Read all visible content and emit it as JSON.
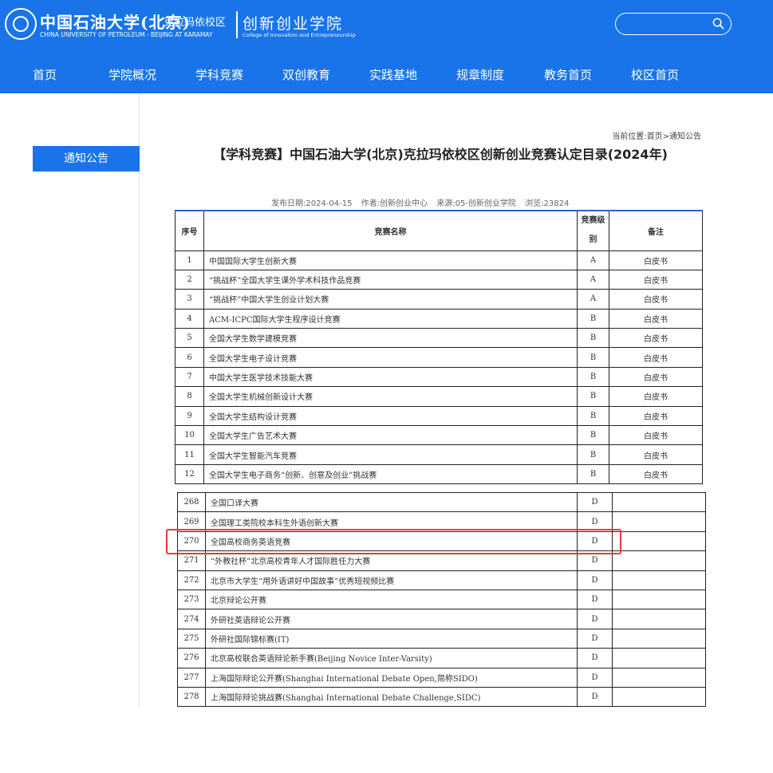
{
  "header": {
    "school_name_cn": "中国石油大学(北京)",
    "campus_name": "克拉玛依校区",
    "school_name_en": "CHINA UNIVERSITY OF PETROLEUM - BEIJING  AT KARAMAY",
    "college_name_cn": "创新创业学院",
    "college_name_en": "College of Innovation and Entrepreneurship",
    "search_placeholder": ""
  },
  "nav": [
    "首页",
    "学院概况",
    "学科竞赛",
    "双创教育",
    "实践基地",
    "规章制度",
    "教务首页",
    "校区首页"
  ],
  "sidebar": {
    "active_item": "通知公告"
  },
  "breadcrumb": {
    "prefix": "当前位置:",
    "home": "首页",
    "sep": ">",
    "current": "通知公告"
  },
  "article": {
    "title": "【学科竞赛】中国石油大学(北京)克拉玛依校区创新创业竞赛认定目录(2024年)",
    "meta": {
      "date": "发布日期:2024-04-15",
      "author": "作者:创新创业中心",
      "source": "来源:05-创新创业学院",
      "views": "浏览:23824"
    }
  },
  "table": {
    "headers": {
      "num": "序号",
      "name": "竞赛名称",
      "level": "竞赛级别",
      "note": "备注"
    },
    "top_rows": [
      {
        "num": "1",
        "name": "中国国际大学生创新大赛",
        "level": "A",
        "note": "白皮书"
      },
      {
        "num": "2",
        "name": "“挑战杯”全国大学生课外学术科技作品竞赛",
        "level": "A",
        "note": "白皮书"
      },
      {
        "num": "3",
        "name": "“挑战杯”中国大学生创业计划大赛",
        "level": "A",
        "note": "白皮书"
      },
      {
        "num": "4",
        "name": "ACM-ICPC国际大学生程序设计竞赛",
        "level": "B",
        "note": "白皮书"
      },
      {
        "num": "5",
        "name": "全国大学生数学建模竞赛",
        "level": "B",
        "note": "白皮书"
      },
      {
        "num": "6",
        "name": "全国大学生电子设计竞赛",
        "level": "B",
        "note": "白皮书"
      },
      {
        "num": "7",
        "name": "中国大学生医学技术技能大赛",
        "level": "B",
        "note": "白皮书"
      },
      {
        "num": "8",
        "name": "全国大学生机械创新设计大赛",
        "level": "B",
        "note": "白皮书"
      },
      {
        "num": "9",
        "name": "全国大学生结构设计竞赛",
        "level": "B",
        "note": "白皮书"
      },
      {
        "num": "10",
        "name": "全国大学生广告艺术大赛",
        "level": "B",
        "note": "白皮书"
      },
      {
        "num": "11",
        "name": "全国大学生智能汽车竞赛",
        "level": "B",
        "note": "白皮书"
      },
      {
        "num": "12",
        "name": "全国大学生电子商务“创新、创意及创业”挑战赛",
        "level": "B",
        "note": "白皮书"
      }
    ],
    "bottom_rows": [
      {
        "num": "268",
        "name": "全国口译大赛",
        "level": "D",
        "note": ""
      },
      {
        "num": "269",
        "name": "全国理工类院校本科生外语创新大赛",
        "level": "D",
        "note": ""
      },
      {
        "num": "270",
        "name": "全国高校商务英语竞赛",
        "level": "D",
        "note": ""
      },
      {
        "num": "271",
        "name": "“外教社杯”北京高校青年人才国际胜任力大赛",
        "level": "D",
        "note": ""
      },
      {
        "num": "272",
        "name": "北京市大学生“用外语讲好中国故事”优秀短视频比赛",
        "level": "D",
        "note": ""
      },
      {
        "num": "273",
        "name": "北京辩论公开赛",
        "level": "D",
        "note": ""
      },
      {
        "num": "274",
        "name": "外研社英语辩论公开赛",
        "level": "D",
        "note": ""
      },
      {
        "num": "275",
        "name": "外研社国际锦标赛(IT)",
        "level": "D",
        "note": ""
      },
      {
        "num": "276",
        "name": "北京高校联合英语辩论新手赛(Beijing Novice Inter-Varsity)",
        "level": "D",
        "note": ""
      },
      {
        "num": "277",
        "name": "上海国际辩论公开赛(Shanghai International Debate Open,简称SIDO)",
        "level": "D",
        "note": ""
      },
      {
        "num": "278",
        "name": "上海国际辩论挑战赛(Shanghai International Debate Challenge,SIDC)",
        "level": "D",
        "note": ""
      }
    ]
  }
}
